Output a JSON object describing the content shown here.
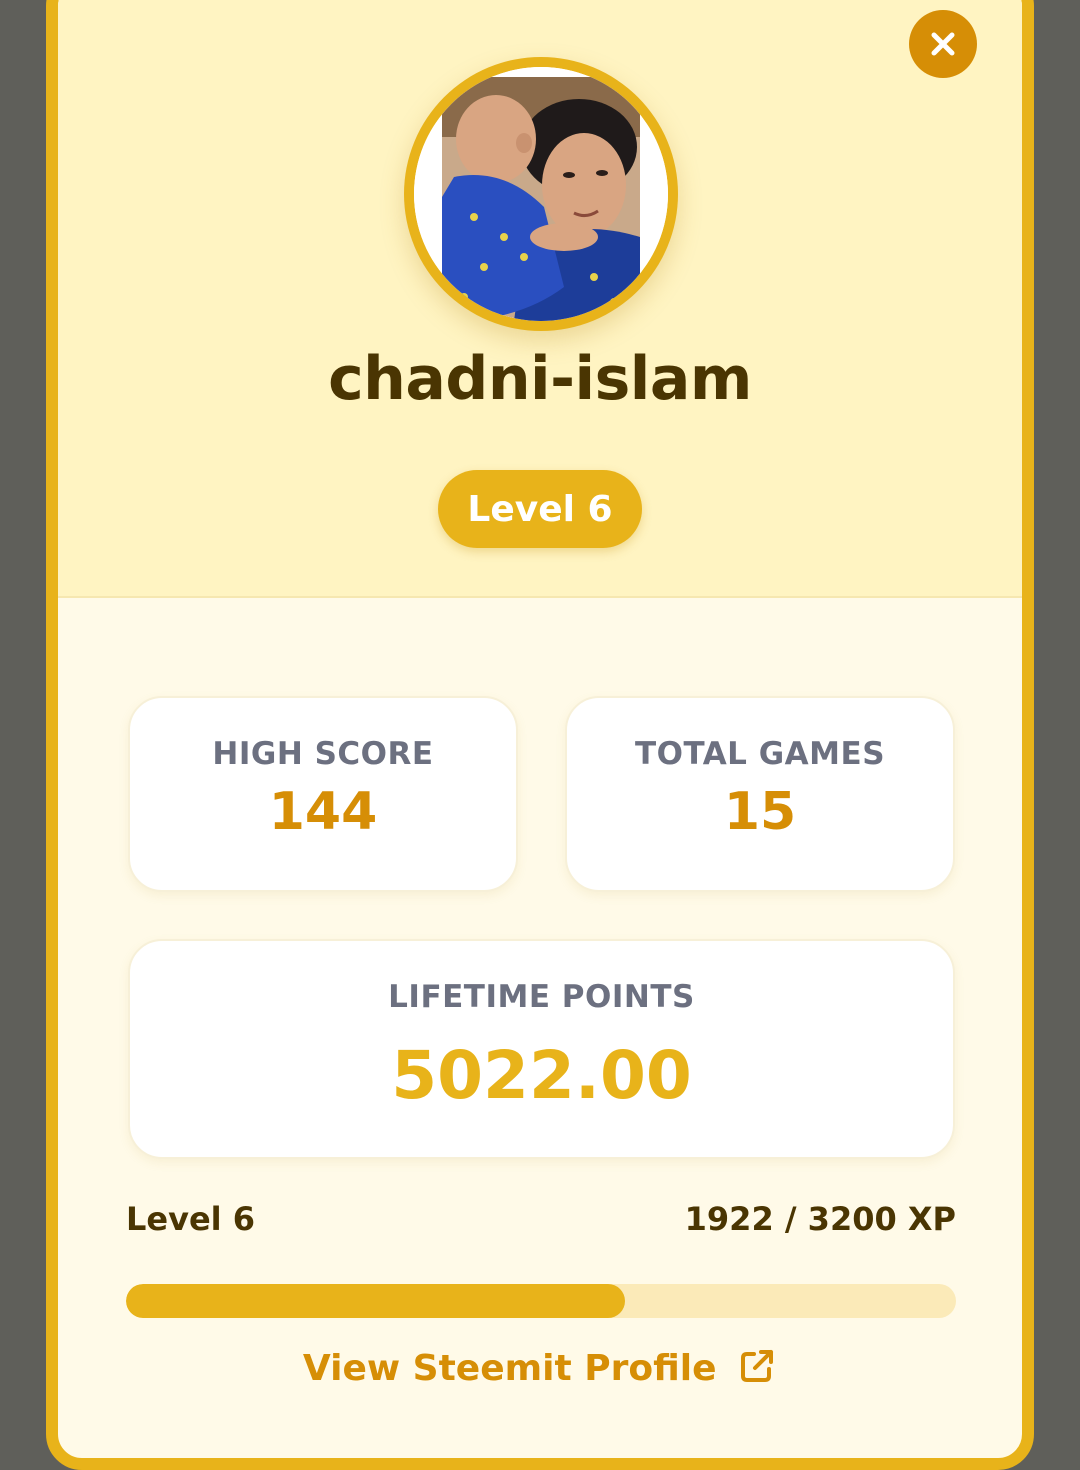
{
  "profile": {
    "username": "chadni-islam",
    "level_badge": "Level 6",
    "avatar_icon": "user-photo"
  },
  "stats": {
    "high_score_label": "HIGH SCORE",
    "high_score_value": "144",
    "total_games_label": "TOTAL GAMES",
    "total_games_value": "15",
    "lifetime_points_label": "LIFETIME POINTS",
    "lifetime_points_value": "5022.00"
  },
  "xp": {
    "level_label": "Level 6",
    "progress_text": "1922 / 3200 XP",
    "current": 1922,
    "max": 3200,
    "fraction": 0.600625
  },
  "link": {
    "label": "View Steemit Profile",
    "icon": "external-link-icon"
  },
  "colors": {
    "accent": "#e8b31a",
    "accent_dark": "#d68e06",
    "text_dark": "#4a3502",
    "label_gray": "#6c7080"
  }
}
